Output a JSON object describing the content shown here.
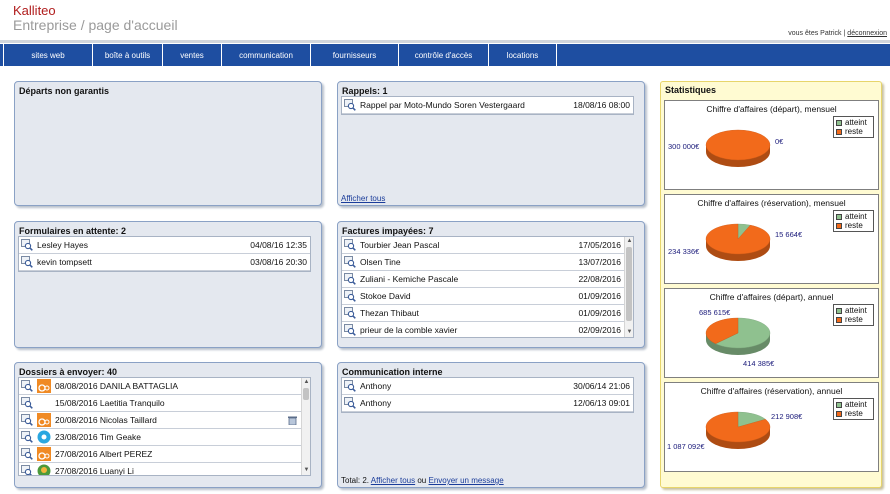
{
  "brand": {
    "name": "Kalliteo",
    "subtitle": "Entreprise / page d'accueil"
  },
  "user": {
    "text": "vous êtes Patrick",
    "sep": "|",
    "logout": "déconnexion"
  },
  "nav": [
    "sites web",
    "boîte à outils",
    "ventes",
    "communication",
    "fournisseurs",
    "contrôle d'accès",
    "locations"
  ],
  "departs": {
    "title": "Départs non garantis"
  },
  "rappels": {
    "title": "Rappels: 1",
    "rows": [
      {
        "label": "Rappel par Moto-Mundo Soren Vestergaard",
        "date": "18/08/16 08:00"
      }
    ],
    "link": "Afficher tous"
  },
  "formulaires": {
    "title": "Formulaires en attente: 2",
    "rows": [
      {
        "label": "Lesley Hayes",
        "date": "04/08/16 12:35"
      },
      {
        "label": "kevin tompsett",
        "date": "03/08/16 20:30"
      }
    ]
  },
  "factures": {
    "title": "Factures impayées: 7",
    "rows": [
      {
        "label": "Tourbier Jean Pascal",
        "date": "17/05/2016"
      },
      {
        "label": "Olsen Tine",
        "date": "13/07/2016"
      },
      {
        "label": "Zuliani - Kemiche Pascale",
        "date": "22/08/2016"
      },
      {
        "label": "Stokoe David",
        "date": "01/09/2016"
      },
      {
        "label": "Thezan Thibaut",
        "date": "01/09/2016"
      },
      {
        "label": "prieur de la comble xavier",
        "date": "02/09/2016"
      }
    ]
  },
  "dossiers": {
    "title": "Dossiers à envoyer: 40",
    "rows": [
      {
        "label": "08/08/2016 DANILA BATTAGLIA",
        "avatar": "orange"
      },
      {
        "label": "15/08/2016 Laetitia Tranquilo",
        "avatar": "none"
      },
      {
        "label": "20/08/2016 Nicolas Taillard",
        "avatar": "orange"
      },
      {
        "label": "23/08/2016 Tim Geake",
        "avatar": "blue"
      },
      {
        "label": "27/08/2016 Albert PEREZ",
        "avatar": "orange"
      },
      {
        "label": "27/08/2016 Luanyi Li",
        "avatar": "green"
      }
    ]
  },
  "communication": {
    "title": "Communication interne",
    "rows": [
      {
        "label": "Anthony",
        "date": "30/06/14 21:06"
      },
      {
        "label": "Anthony",
        "date": "12/06/13 09:01"
      }
    ],
    "footer_prefix": "Total: 2.",
    "footer_link1": "Afficher tous",
    "footer_mid": "ou",
    "footer_link2": "Envoyer un message"
  },
  "stats": {
    "title": "Statistiques",
    "legend": [
      "atteint",
      "reste"
    ],
    "colors": {
      "atteint": "#8fc18f",
      "reste": "#f26a1b"
    },
    "charts": [
      {
        "title": "Chiffre d'affaires (départ), mensuel",
        "atteint": "0€",
        "reste": "300 000€",
        "atteint_value": 0,
        "reste_value": 300000
      },
      {
        "title": "Chiffre d'affaires (réservation), mensuel",
        "atteint": "15 664€",
        "reste": "234 336€",
        "atteint_value": 15664,
        "reste_value": 234336
      },
      {
        "title": "Chiffre d'affaires (départ), annuel",
        "atteint": "685 615€",
        "reste": "414 385€",
        "atteint_value": 685615,
        "reste_value": 414385
      },
      {
        "title": "Chiffre d'affaires (réservation), annuel",
        "atteint": "212 908€",
        "reste": "1 087 092€",
        "atteint_value": 212908,
        "reste_value": 1087092
      }
    ]
  }
}
